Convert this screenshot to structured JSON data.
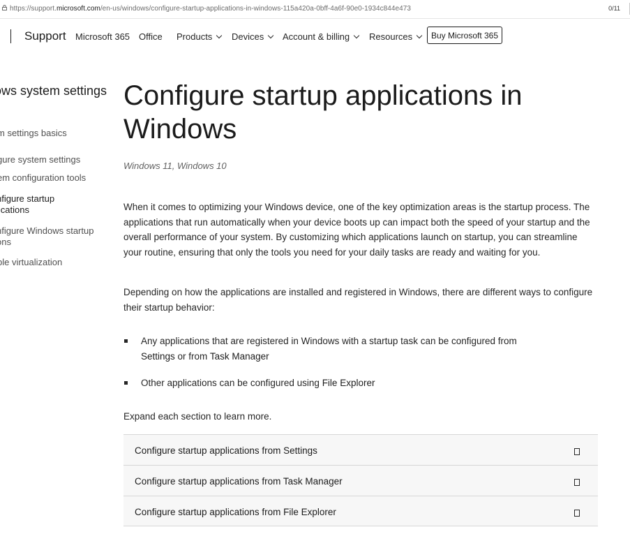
{
  "browser": {
    "url_prefix": "https://support.",
    "url_host": "microsoft.com",
    "url_path": "/en-us/windows/configure-startup-applications-in-windows-115a420a-0bff-4a6f-90e0-1934c844e473",
    "find_counter": "0/11"
  },
  "nav": {
    "brand": "Support",
    "items": [
      "Microsoft 365",
      "Office",
      "Products",
      "Devices",
      "Account & billing",
      "Resources"
    ],
    "buy_label": "Buy Microsoft 365"
  },
  "sidebar": {
    "title": "ows system settings",
    "items": [
      {
        "label": "m settings basics"
      },
      {
        "label": "gure system settings"
      },
      {
        "label": "em configuration tools"
      },
      {
        "label_line1": "nfigure startup",
        "label_line2": "lications"
      },
      {
        "label_line1": "nfigure Windows startup",
        "label_line2": "ons"
      },
      {
        "label": "ble virtualization"
      }
    ]
  },
  "article": {
    "title": "Configure startup applications in Windows",
    "applies_to": "Windows 11, Windows 10",
    "intro": "When it comes to optimizing your Windows device, one of the key optimization areas is the startup process. The applications that run automatically when your device boots up can impact both the speed of your startup and the overall performance of your system. By customizing which applications launch on startup, you can streamline your routine, ensuring that only the tools you need for your daily tasks are ready and waiting for you.",
    "depending": "Depending on how the applications are installed and registered in Windows, there are different ways to configure their startup behavior:",
    "bullet1_a": "Any applications that are registered in Windows with a startup task can be configured from",
    "bullet1_settings": "Settings",
    "bullet1_or": "or from",
    "bullet1_tm": "Task Manager",
    "bullet2_a": "Other applications can be configured using",
    "bullet2_fe": "File Explorer",
    "expand_note": "Expand each section to learn more."
  },
  "accordion": [
    {
      "label": "Configure startup applications from Settings"
    },
    {
      "label": "Configure startup applications from Task Manager"
    },
    {
      "label": "Configure startup applications from File Explorer"
    }
  ]
}
